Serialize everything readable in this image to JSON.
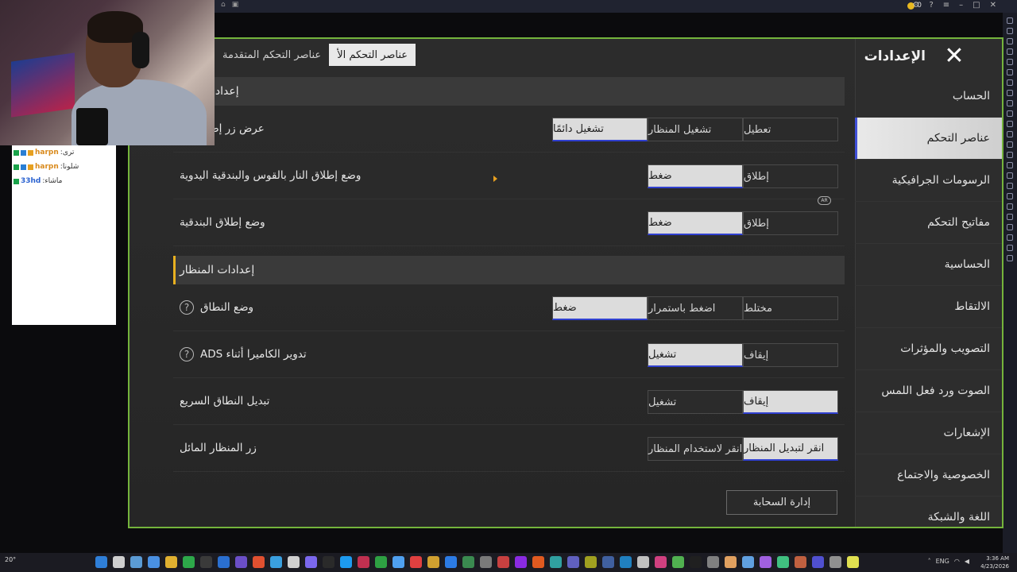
{
  "emulator": {
    "coins": "0"
  },
  "chat": [
    {
      "user": "harpn",
      "msg": ":تری"
    },
    {
      "user": "harpn",
      "msg": ":شلونا"
    },
    {
      "user": "33hd",
      "msg": ":ماشاء"
    }
  ],
  "game": {
    "title": "الإعدادات",
    "nav": [
      "الحساب",
      "عناصر التحكم",
      "الرسومات الجرافيكية",
      "مفاتيح التحكم",
      "الحساسية",
      "الالتقاط",
      "التصويب والمؤثرات",
      "الصوت ورد فعل اللمس",
      "الإشعارات",
      "الخصوصية والاجتماع",
      "اللغة والشبكة"
    ],
    "tabs": [
      "عناصر التحكم المتقدمة",
      "عناصر التحكم الأ"
    ],
    "section1": "إعدادات إطلا",
    "section2": "إعدادات المنظار",
    "rows": [
      {
        "label": "عرض زر إطلاق النا",
        "options": [
          "تعطيل",
          "تشغيل المنظار",
          "تشغيل دائمًا"
        ]
      },
      {
        "label": "وضع إطلاق النار بالقوس والبندقية اليدوية",
        "options": [
          "إطلاق",
          "ضغط"
        ]
      },
      {
        "label": "وضع إطلاق البندقية",
        "options": [
          "إطلاق",
          "ضغط"
        ]
      },
      {
        "label": "وضع النطاق",
        "options": [
          "مختلط",
          "اضغط باستمرار",
          "ضغط"
        ]
      },
      {
        "label": "تدوير الكاميرا أثناء ADS",
        "options": [
          "إيقاف",
          "تشغيل"
        ]
      },
      {
        "label": "تبديل النطاق السريع",
        "options": [
          "إيقاف",
          "تشغيل"
        ]
      },
      {
        "label": "زر المنظار المائل",
        "options": [
          "انقر لتبديل المنظار",
          "انقر لاستخدام المنظار"
        ]
      }
    ],
    "selected": [
      2,
      1,
      1,
      2,
      1,
      0,
      0
    ],
    "cloud_button": "إدارة السحابة",
    "ar_badge": "AR"
  },
  "taskbar": {
    "weather": "20°",
    "lang": "ENG",
    "time": "3:36 AM",
    "date": "4/23/2026"
  },
  "colors": {
    "panel_border": "#74b43c",
    "accent_blue": "#3040d0",
    "section_bar": "#e8b020"
  }
}
